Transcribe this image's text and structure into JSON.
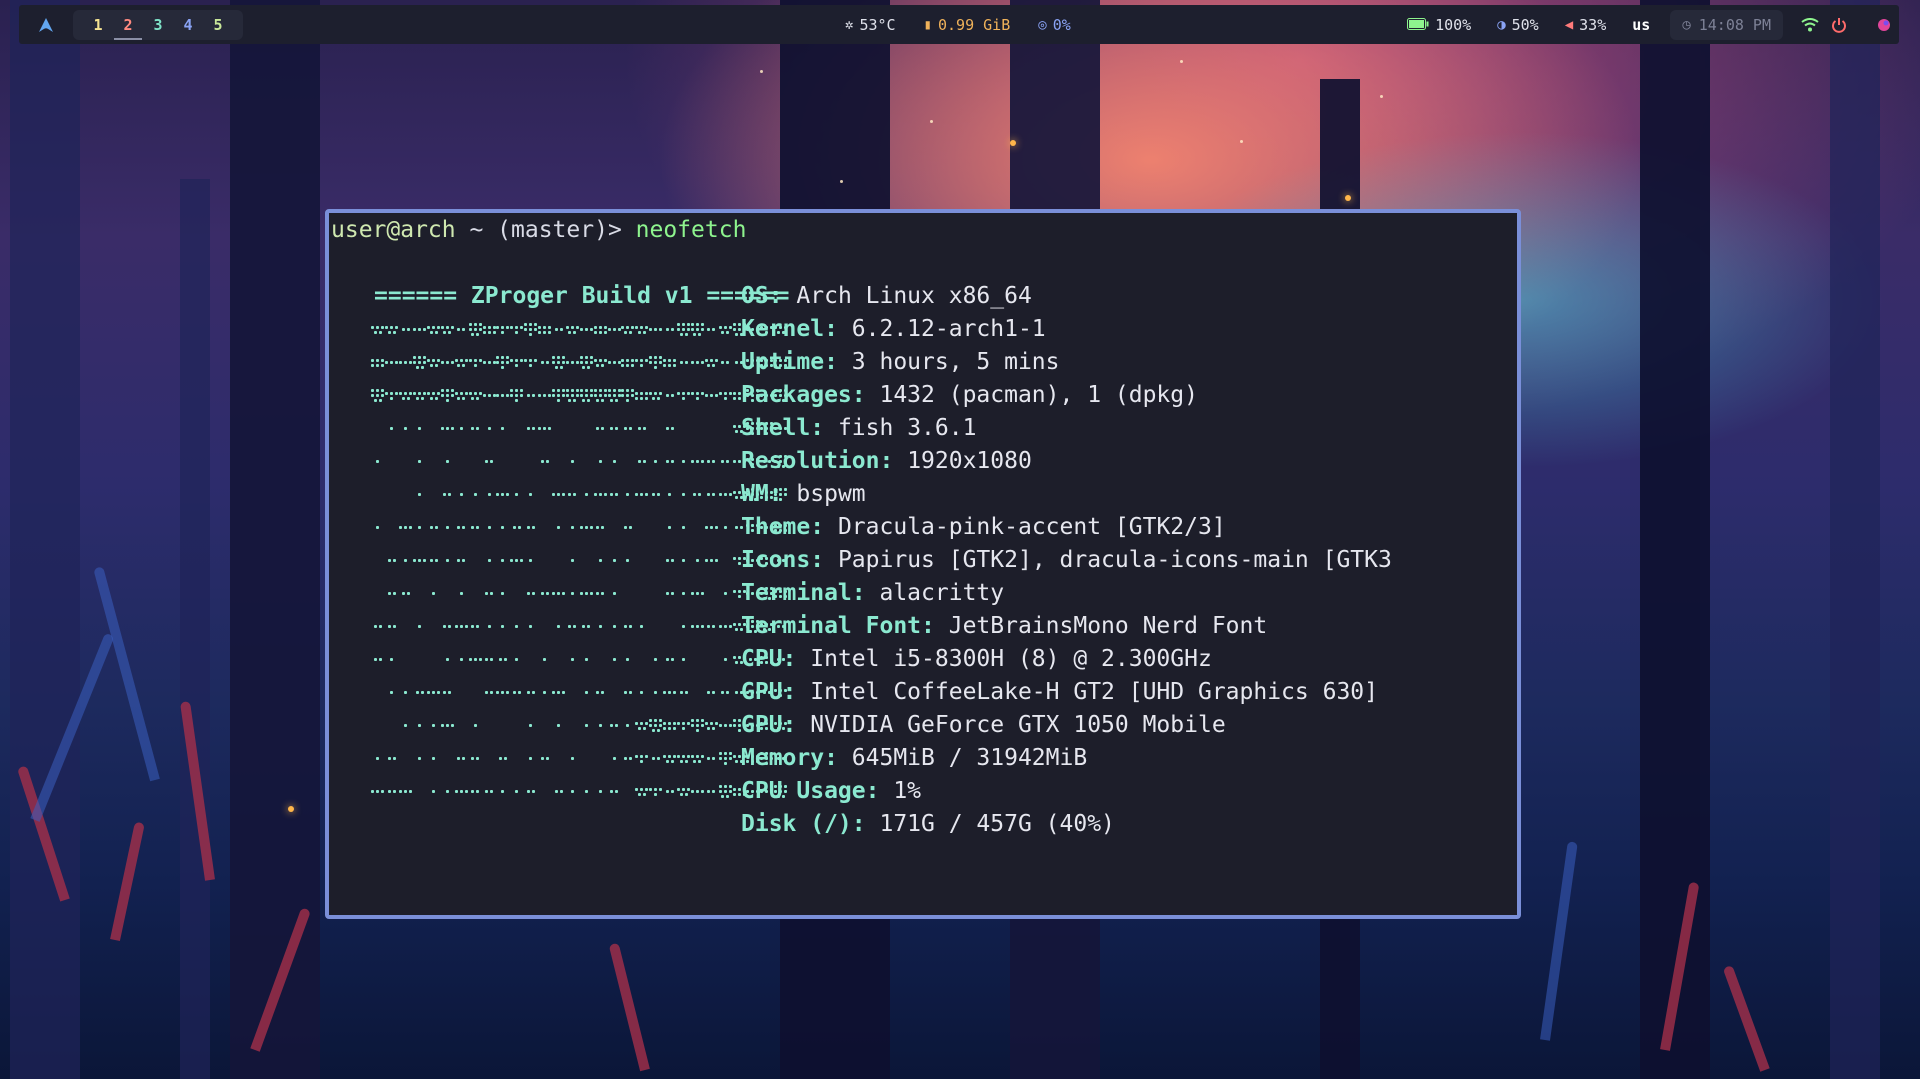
{
  "topbar": {
    "workspaces": [
      "1",
      "2",
      "3",
      "4",
      "5"
    ],
    "temperature": "53°C",
    "memory": "0.99 GiB",
    "cpu": "0%",
    "battery": "100%",
    "brightness": "50%",
    "volume": "33%",
    "keyboard_layout": "us",
    "clock": "14:08 PM",
    "icons": {
      "launcher": "arch-logo-icon",
      "temperature": "snowflake-icon",
      "memory": "memory-chip-icon",
      "cpu": "cpu-icon",
      "battery": "battery-full-icon",
      "brightness": "brightness-icon",
      "volume": "speaker-icon",
      "clock": "clock-icon",
      "wifi": "wifi-icon",
      "power": "power-icon",
      "profile": "palette-icon"
    }
  },
  "terminal": {
    "prompt_user": "user@arch",
    "prompt_rest": " ~ (master)> ",
    "command": "neofetch",
    "art_title": "====== ZProger Build v1 ======",
    "info": [
      {
        "key": "OS",
        "value": "Arch Linux x86_64"
      },
      {
        "key": "Kernel",
        "value": "6.2.12-arch1-1"
      },
      {
        "key": "Uptime",
        "value": "3 hours, 5 mins"
      },
      {
        "key": "Packages",
        "value": "1432 (pacman), 1 (dpkg)"
      },
      {
        "key": "Shell",
        "value": "fish 3.6.1"
      },
      {
        "key": "Resolution",
        "value": "1920x1080"
      },
      {
        "key": "WM",
        "value": "bspwm"
      },
      {
        "key": "Theme",
        "value": "Dracula-pink-accent [GTK2/3]"
      },
      {
        "key": "Icons",
        "value": "Papirus [GTK2], dracula-icons-main [GTK3"
      },
      {
        "key": "Terminal",
        "value": "alacritty"
      },
      {
        "key": "Terminal Font",
        "value": "JetBrainsMono Nerd Font"
      },
      {
        "key": "CPU",
        "value": "Intel i5-8300H (8) @ 2.300GHz"
      },
      {
        "key": "GPU",
        "value": "Intel CoffeeLake-H GT2 [UHD Graphics 630]"
      },
      {
        "key": "GPU",
        "value": "NVIDIA GeForce GTX 1050 Mobile"
      },
      {
        "key": "Memory",
        "value": "645MiB / 31942MiB"
      },
      {
        "key": "CPU Usage",
        "value": "1%"
      },
      {
        "key": "Disk (/)",
        "value": "171G / 457G (40%)"
      }
    ],
    "colors": {
      "accent": "#8be9d0",
      "border": "#7a8fd9",
      "background": "#1d1e2a"
    }
  }
}
